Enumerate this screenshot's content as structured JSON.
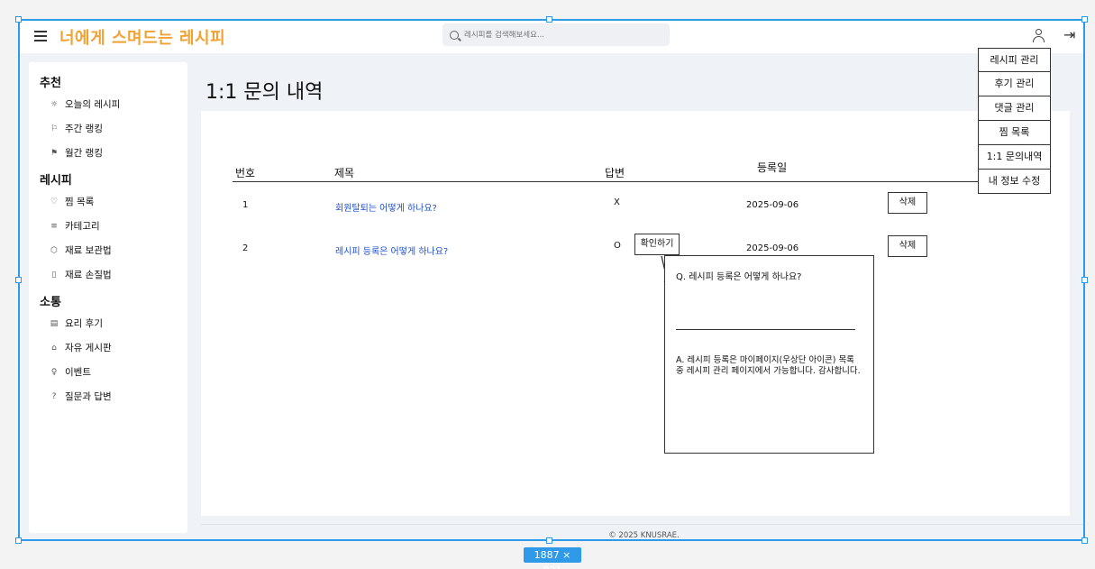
{
  "app": {
    "logo": "너에게 스며드는 레시피"
  },
  "search": {
    "placeholder": "레시피를 검색해보세요..."
  },
  "sidebar": {
    "sections": [
      {
        "title": "추천",
        "items": [
          {
            "icon": "sun-icon",
            "glyph": "☼",
            "label": "오늘의 레시피"
          },
          {
            "icon": "flag-outline-icon",
            "glyph": "⚐",
            "label": "주간 랭킹"
          },
          {
            "icon": "flag-icon",
            "glyph": "⚑",
            "label": "월간 랭킹"
          }
        ]
      },
      {
        "title": "레시피",
        "items": [
          {
            "icon": "heart-icon",
            "glyph": "♡",
            "label": "찜 목록"
          },
          {
            "icon": "list-icon",
            "glyph": "≡",
            "label": "카테고리"
          },
          {
            "icon": "box-icon",
            "glyph": "⬡",
            "label": "재료 보관법"
          },
          {
            "icon": "clipboard-icon",
            "glyph": "▯",
            "label": "재료 손질법"
          }
        ]
      },
      {
        "title": "소통",
        "items": [
          {
            "icon": "book-icon",
            "glyph": "▤",
            "label": "요리 후기"
          },
          {
            "icon": "board-icon",
            "glyph": "⌂",
            "label": "자유 게시판"
          },
          {
            "icon": "bulb-icon",
            "glyph": "♀",
            "label": "이벤트"
          },
          {
            "icon": "question-icon",
            "glyph": "?",
            "label": "질문과 답변"
          }
        ]
      }
    ]
  },
  "page": {
    "title": "1:1 문의 내역"
  },
  "table": {
    "headers": {
      "no": "번호",
      "title": "제목",
      "answer": "답변",
      "date": "등록일"
    },
    "rows": [
      {
        "no": "1",
        "title": "회원탈퇴는 어떻게 하나요?",
        "answer": "X",
        "date": "2025-09-06",
        "delete": "삭제"
      },
      {
        "no": "2",
        "title": "레시피 등록은 어떻게 하나요?",
        "answer": "O",
        "date": "2025-09-06",
        "delete": "삭제"
      }
    ]
  },
  "confirm_button": "확인하기",
  "popup": {
    "question": "Q. 레시피 등록은 어떻게 하나요?",
    "answer": "A. 레시피 등록은 마이페이지(우상단 아이콘) 목록 중 레시피 관리 페이지에서 가능합니다. 감사합니다."
  },
  "footer": "© 2025 KNUSRAE.",
  "dropdown": [
    "레시피 관리",
    "후기 관리",
    "댓글 관리",
    "찜 목록",
    "1:1 문의내역",
    "내 정보 수정"
  ],
  "canvas_size_label": "1887 × 921",
  "colors": {
    "accent": "#f0a233",
    "link": "#1d4fd0",
    "selection": "#2f9be8"
  }
}
